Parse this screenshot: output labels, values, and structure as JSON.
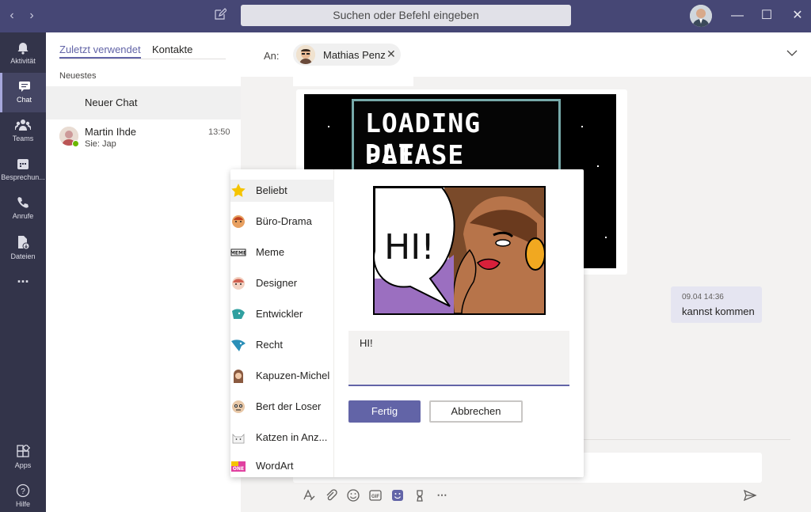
{
  "search": {
    "placeholder": "Suchen oder Befehl eingeben"
  },
  "rail": {
    "items": [
      {
        "label": "Aktivität",
        "icon": "bell-icon"
      },
      {
        "label": "Chat",
        "icon": "chat-icon"
      },
      {
        "label": "Teams",
        "icon": "teams-icon"
      },
      {
        "label": "Besprechun...",
        "icon": "calendar-icon"
      },
      {
        "label": "Anrufe",
        "icon": "phone-icon"
      },
      {
        "label": "Dateien",
        "icon": "files-icon"
      },
      {
        "label": "Apps",
        "icon": "apps-icon"
      },
      {
        "label": "Hilfe",
        "icon": "help-icon"
      }
    ],
    "more": "..."
  },
  "chat_list": {
    "tabs": [
      "Zuletzt verwendet",
      "Kontakte"
    ],
    "section": "Neuestes",
    "new_chat": "Neuer Chat",
    "contacts": [
      {
        "name": "Martin Ihde",
        "preview": "Sie: Jap",
        "time": "13:50"
      }
    ]
  },
  "conversation": {
    "to_label": "An:",
    "recipient": "Mathias Penz",
    "gif_text": [
      "LOADING DATA",
      "PLEASE WAIT!▌"
    ],
    "reply": {
      "time": "09.04 14:36",
      "text": "kannst kommen"
    }
  },
  "sticker_picker": {
    "categories": [
      {
        "label": "Beliebt",
        "color": "#f5c400"
      },
      {
        "label": "Büro-Drama",
        "color": "#e8a060"
      },
      {
        "label": "Meme",
        "color": "#333333"
      },
      {
        "label": "Designer",
        "color": "#d06050"
      },
      {
        "label": "Entwickler",
        "color": "#30a0a0"
      },
      {
        "label": "Recht",
        "color": "#2a8fb8"
      },
      {
        "label": "Kapuzen-Michel",
        "color": "#8a5a40"
      },
      {
        "label": "Bert der Loser",
        "color": "#b08060"
      },
      {
        "label": "Katzen in Anz...",
        "color": "#dddddd"
      },
      {
        "label": "WordArt",
        "color": "#e040a0"
      }
    ],
    "preview_text": "HI!",
    "caption_value": "HI!",
    "done_label": "Fertig",
    "cancel_label": "Abbrechen"
  },
  "colors": {
    "titlebar": "#464775",
    "rail": "#33344a",
    "accent": "#6264a7"
  }
}
